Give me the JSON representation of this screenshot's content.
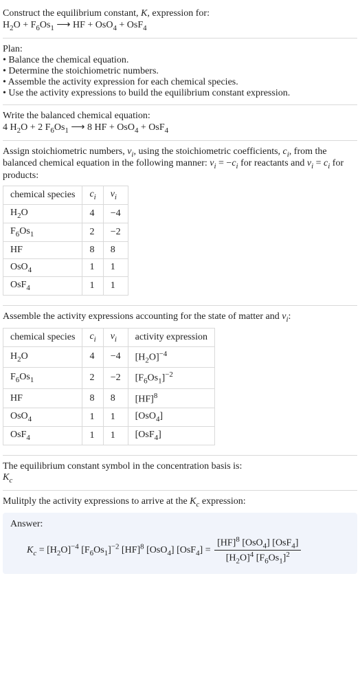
{
  "intro": {
    "line1_prefix": "Construct the equilibrium constant, ",
    "line1_K": "K",
    "line1_suffix": ", expression for:",
    "reaction": {
      "lhs1_base": "H",
      "lhs1_s1": "2",
      "lhs1_base2": "O",
      "plus": " + ",
      "lhs2_base": "F",
      "lhs2_s1": "6",
      "lhs2_base2": "Os",
      "lhs2_s2": "1",
      "arrow": " ⟶ ",
      "rhs1": "HF",
      "rhs2_base": "OsO",
      "rhs2_s": "4",
      "rhs3_base": "OsF",
      "rhs3_s": "4"
    }
  },
  "plan": {
    "heading": "Plan:",
    "b1": "• Balance the chemical equation.",
    "b2": "• Determine the stoichiometric numbers.",
    "b3": "• Assemble the activity expression for each chemical species.",
    "b4": "• Use the activity expressions to build the equilibrium constant expression."
  },
  "balanced": {
    "heading": "Write the balanced chemical equation:",
    "c_lhs1": "4 ",
    "c_lhs2": "2 ",
    "c_rhs1": "8 "
  },
  "assign": {
    "p1": "Assign stoichiometric numbers, ",
    "vi": "ν",
    "vi_sub": "i",
    "p2": ", using the stoichiometric coefficients, ",
    "ci": "c",
    "ci_sub": "i",
    "p3": ", from the balanced chemical equation in the following manner: ",
    "eqr1a": "ν",
    "eqr1b": "i",
    "eqr1c": " = −",
    "eqr1d": "c",
    "eqr1e": "i",
    "p4": " for reactants and ",
    "eqp1a": "ν",
    "eqp1b": "i",
    "eqp1c": " = ",
    "eqp1d": "c",
    "eqp1e": "i",
    "p5": " for products:"
  },
  "table1": {
    "h1": "chemical species",
    "h2": "c",
    "h2s": "i",
    "h3": "ν",
    "h3s": "i",
    "rows": [
      {
        "sp_a": "H",
        "sp_b": "2",
        "sp_c": "O",
        "sp_d": "",
        "sp_e": "",
        "c": "4",
        "v": "−4"
      },
      {
        "sp_a": "F",
        "sp_b": "6",
        "sp_c": "Os",
        "sp_d": "1",
        "sp_e": "",
        "c": "2",
        "v": "−2"
      },
      {
        "sp_a": "HF",
        "sp_b": "",
        "sp_c": "",
        "sp_d": "",
        "sp_e": "",
        "c": "8",
        "v": "8"
      },
      {
        "sp_a": "OsO",
        "sp_b": "4",
        "sp_c": "",
        "sp_d": "",
        "sp_e": "",
        "c": "1",
        "v": "1"
      },
      {
        "sp_a": "OsF",
        "sp_b": "4",
        "sp_c": "",
        "sp_d": "",
        "sp_e": "",
        "c": "1",
        "v": "1"
      }
    ]
  },
  "assemble": {
    "p1": "Assemble the activity expressions accounting for the state of matter and ",
    "vi": "ν",
    "vi_sub": "i",
    "p2": ":"
  },
  "table2": {
    "h1": "chemical species",
    "h2": "c",
    "h2s": "i",
    "h3": "ν",
    "h3s": "i",
    "h4": "activity expression",
    "rows": [
      {
        "sp_a": "H",
        "sp_b": "2",
        "sp_c": "O",
        "c": "4",
        "v": "−4",
        "ae_a": "[H",
        "ae_b": "2",
        "ae_c": "O]",
        "ae_sup": "−4"
      },
      {
        "sp_a": "F",
        "sp_b": "6",
        "sp_c": "Os",
        "sp_d": "1",
        "c": "2",
        "v": "−2",
        "ae_a": "[F",
        "ae_b": "6",
        "ae_c": "Os",
        "ae_d": "1",
        "ae_e": "]",
        "ae_sup": "−2"
      },
      {
        "sp_a": "HF",
        "c": "8",
        "v": "8",
        "ae_a": "[HF]",
        "ae_sup": "8"
      },
      {
        "sp_a": "OsO",
        "sp_b": "4",
        "c": "1",
        "v": "1",
        "ae_a": "[OsO",
        "ae_b": "4",
        "ae_c": "]"
      },
      {
        "sp_a": "OsF",
        "sp_b": "4",
        "c": "1",
        "v": "1",
        "ae_a": "[OsF",
        "ae_b": "4",
        "ae_c": "]"
      }
    ]
  },
  "kc_symbol": {
    "line1": "The equilibrium constant symbol in the concentration basis is:",
    "K": "K",
    "Ksub": "c"
  },
  "multiply": {
    "p1": "Mulitply the activity expressions to arrive at the ",
    "K": "K",
    "Ksub": "c",
    "p2": " expression:"
  },
  "answer": {
    "label": "Answer:",
    "K": "K",
    "Ksub": "c",
    "eq": " = ",
    "t1": "[H",
    "t1b": "2",
    "t1c": "O]",
    "t1sup": "−4",
    "sp": " ",
    "t2": "[F",
    "t2b": "6",
    "t2c": "Os",
    "t2d": "1",
    "t2e": "]",
    "t2sup": "−2",
    "t3": "[HF]",
    "t3sup": "8",
    "t4": "[OsO",
    "t4b": "4",
    "t4c": "]",
    "t5": "[OsF",
    "t5b": "4",
    "t5c": "]",
    "eq2": " = ",
    "num1": "[HF]",
    "num1sup": "8",
    "num2": "[OsO",
    "num2b": "4",
    "num2c": "]",
    "num3": "[OsF",
    "num3b": "4",
    "num3c": "]",
    "den1": "[H",
    "den1b": "2",
    "den1c": "O]",
    "den1sup": "4",
    "den2": "[F",
    "den2b": "6",
    "den2c": "Os",
    "den2d": "1",
    "den2e": "]",
    "den2sup": "2"
  }
}
